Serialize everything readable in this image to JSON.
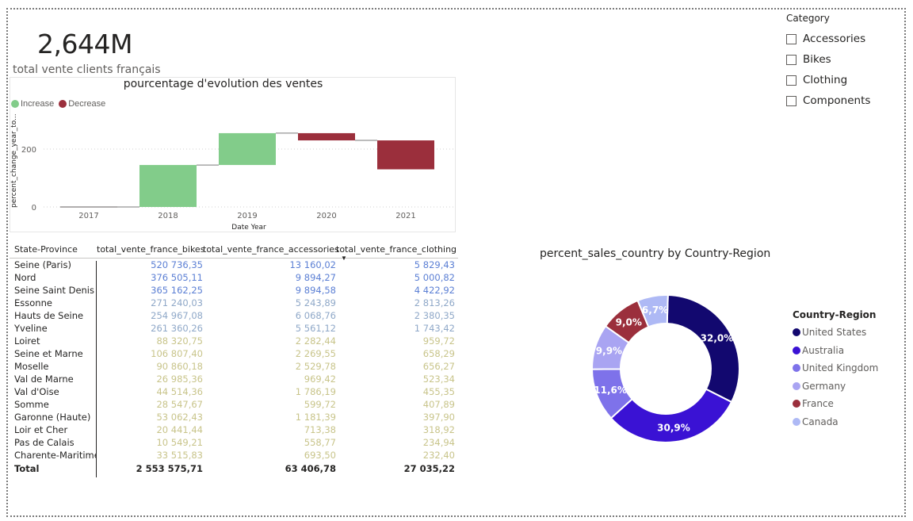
{
  "kpi": {
    "value": "2,644M",
    "label": "total vente clients français"
  },
  "waterfall": {
    "title": "pourcentage d'evolution des ventes",
    "legend": [
      {
        "label": "Increase",
        "color": "#82cc8a"
      },
      {
        "label": "Decrease",
        "color": "#9b2f3c"
      }
    ],
    "ylabel": "percent_change_year_to...",
    "xlabel": "Date Year",
    "yticks": [
      "0",
      "200"
    ]
  },
  "chart_data": [
    {
      "type": "bar",
      "subtype": "waterfall",
      "title": "pourcentage d'evolution des ventes",
      "xlabel": "Date Year",
      "ylabel": "percent_change_year_to...",
      "categories": [
        "2017",
        "2018",
        "2019",
        "2020",
        "2021"
      ],
      "values": [
        0,
        145,
        110,
        -25,
        -100
      ],
      "cumulative_start": [
        0,
        0,
        145,
        255,
        230
      ],
      "cumulative_end": [
        0,
        145,
        255,
        230,
        130
      ],
      "ylim": [
        -20,
        330
      ],
      "yticks": [
        0,
        200
      ],
      "grid": true,
      "legend": "top-left"
    },
    {
      "type": "pie",
      "subtype": "donut",
      "title": "percent_sales_country by Country-Region",
      "categories": [
        "United States",
        "Australia",
        "United Kingdom",
        "Germany",
        "France",
        "Canada"
      ],
      "values": [
        32.0,
        30.9,
        11.6,
        9.9,
        9.0,
        6.7
      ],
      "labels": [
        "32,0%",
        "30,9%",
        "11,6%",
        "9,9%",
        "9,0%",
        "6,7%"
      ],
      "colors": [
        "#12086f",
        "#3a12d4",
        "#7e72ea",
        "#a9a4f2",
        "#9b2f3c",
        "#aeb9f5"
      ],
      "legend": "right"
    }
  ],
  "table": {
    "headers": [
      "State-Province",
      "total_vente_france_bikes",
      "total_vente_france_accessories",
      "total_vente_france_clothing"
    ],
    "rows": [
      {
        "name": "Seine (Paris)",
        "v": [
          "520 736,35",
          "13 160,02",
          "5 829,43"
        ],
        "tone": "blue"
      },
      {
        "name": "Nord",
        "v": [
          "376 505,11",
          "9 894,27",
          "5 000,82"
        ],
        "tone": "blue"
      },
      {
        "name": "Seine Saint Denis",
        "v": [
          "365 162,25",
          "9 894,58",
          "4 422,92"
        ],
        "tone": "blue"
      },
      {
        "name": "Essonne",
        "v": [
          "271 240,03",
          "5 243,89",
          "2 813,26"
        ],
        "tone": "lblue"
      },
      {
        "name": "Hauts de Seine",
        "v": [
          "254 967,08",
          "6 068,76",
          "2 380,35"
        ],
        "tone": "lblue"
      },
      {
        "name": "Yveline",
        "v": [
          "261 360,26",
          "5 561,12",
          "1 743,42"
        ],
        "tone": "lblue"
      },
      {
        "name": "Loiret",
        "v": [
          "88 320,75",
          "2 282,44",
          "959,72"
        ],
        "tone": "tan"
      },
      {
        "name": "Seine et Marne",
        "v": [
          "106 807,40",
          "2 269,55",
          "658,29"
        ],
        "tone": "tan"
      },
      {
        "name": "Moselle",
        "v": [
          "90 860,18",
          "2 529,78",
          "656,27"
        ],
        "tone": "tan"
      },
      {
        "name": "Val de Marne",
        "v": [
          "26 985,36",
          "969,42",
          "523,34"
        ],
        "tone": "tan"
      },
      {
        "name": "Val d'Oise",
        "v": [
          "44 514,36",
          "1 786,19",
          "455,35"
        ],
        "tone": "tan"
      },
      {
        "name": "Somme",
        "v": [
          "28 547,67",
          "599,72",
          "407,89"
        ],
        "tone": "tan"
      },
      {
        "name": "Garonne (Haute)",
        "v": [
          "53 062,43",
          "1 181,39",
          "397,90"
        ],
        "tone": "tan"
      },
      {
        "name": "Loir et Cher",
        "v": [
          "20 441,44",
          "713,38",
          "318,92"
        ],
        "tone": "tan"
      },
      {
        "name": "Pas de Calais",
        "v": [
          "10 549,21",
          "558,77",
          "234,94"
        ],
        "tone": "tan"
      },
      {
        "name": "Charente-Maritime",
        "v": [
          "33 515,83",
          "693,50",
          "232,40"
        ],
        "tone": "tan"
      }
    ],
    "total": {
      "name": "Total",
      "v": [
        "2 553 575,71",
        "63 406,78",
        "27 035,22"
      ]
    },
    "sorted_column": "total_vente_france_clothing"
  },
  "donut": {
    "title": "percent_sales_country by Country-Region",
    "legend_title": "Country-Region"
  },
  "slicer": {
    "title": "Category",
    "options": [
      "Accessories",
      "Bikes",
      "Clothing",
      "Components"
    ]
  }
}
